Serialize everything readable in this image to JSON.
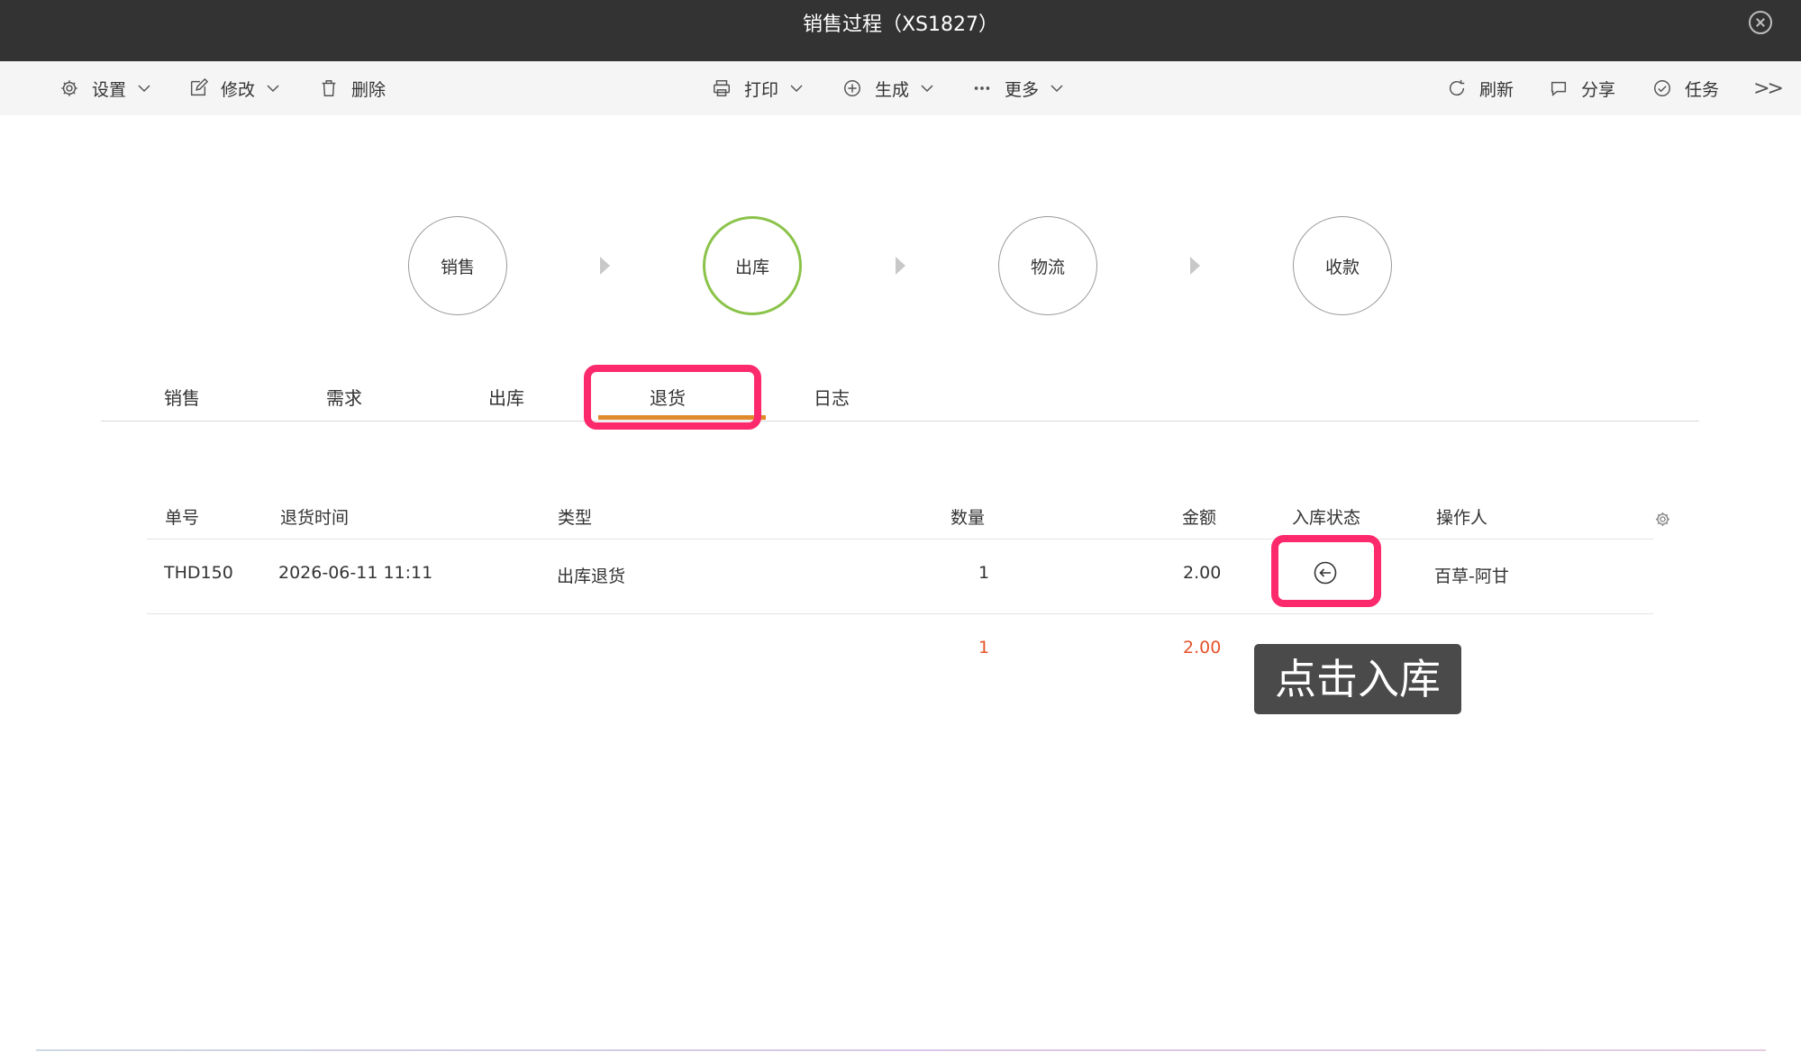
{
  "window": {
    "title": "销售过程（XS1827）"
  },
  "toolbar": {
    "settings": "设置",
    "edit": "修改",
    "delete": "删除",
    "print": "打印",
    "generate": "生成",
    "more": "更多",
    "refresh": "刷新",
    "share": "分享",
    "task": "任务",
    "expand": ">>"
  },
  "steps": [
    "销售",
    "出库",
    "物流",
    "收款"
  ],
  "active_step": "出库",
  "tabs": [
    "销售",
    "需求",
    "出库",
    "退货",
    "日志"
  ],
  "active_tab": "退货",
  "table": {
    "headers": [
      "单号",
      "退货时间",
      "类型",
      "数量",
      "金额",
      "入库状态",
      "操作人"
    ],
    "rows": [
      {
        "id": "THD150",
        "time": "2026-06-11 11:11",
        "type": "出库退货",
        "qty": "1",
        "amount": "2.00",
        "status_icon": "return-in-icon",
        "operator": "百草-阿甘"
      }
    ],
    "totals": {
      "qty": "1",
      "amount": "2.00"
    }
  },
  "tooltip": "点击入库",
  "colors": {
    "titlebar": "#333333",
    "active_step": "#8bc34a",
    "tab_underline": "#e08a2c",
    "highlight": "#fc2a6c",
    "total_text": "#e5532b"
  }
}
